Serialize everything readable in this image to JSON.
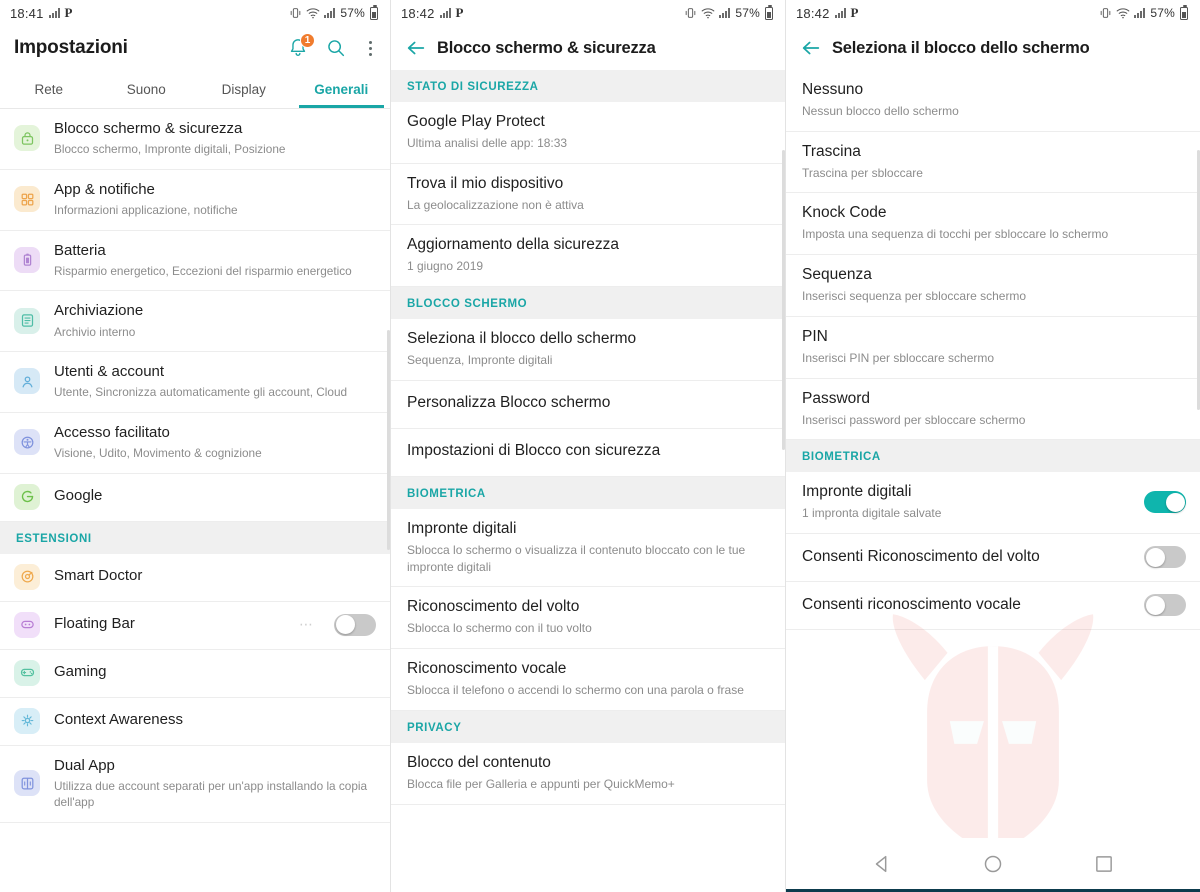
{
  "statusbar": {
    "time_left": "18:41",
    "time_mid": "18:42",
    "time_right": "18:42",
    "carrier_glyph": "P",
    "battery_pct": "57%",
    "icons": [
      "signal-bars-icon",
      "vibrate-icon",
      "wifi-icon",
      "cellular-icon",
      "battery-icon"
    ]
  },
  "colors": {
    "accent_teal": "#1aa6a6",
    "toggle_on": "#0fb5ad",
    "badge_orange": "#f07c2e",
    "section_bg": "#f0f0f0",
    "navbar_line": "#0d3b4d"
  },
  "left": {
    "title": "Impostazioni",
    "notification_count": "1",
    "actions": [
      "notifications-bell-icon",
      "search-icon",
      "overflow-menu-icon"
    ],
    "tabs": [
      {
        "label": "Rete",
        "active": false
      },
      {
        "label": "Suono",
        "active": false
      },
      {
        "label": "Display",
        "active": false
      },
      {
        "label": "Generali",
        "active": true
      }
    ],
    "items": [
      {
        "title": "Blocco schermo & sicurezza",
        "sub": "Blocco schermo, Impronte digitali, Posizione",
        "icon": "lock-icon",
        "color": "#8ed07a",
        "bg": "#e4f4da"
      },
      {
        "title": "App & notifiche",
        "sub": "Informazioni applicazione, notifiche",
        "icon": "apps-icon",
        "color": "#f0ad5a",
        "bg": "#fbeacf"
      },
      {
        "title": "Batteria",
        "sub": "Risparmio energetico, Eccezioni del risparmio energetico",
        "icon": "battery-icon",
        "color": "#b98fd6",
        "bg": "#eddcf6"
      },
      {
        "title": "Archiviazione",
        "sub": "Archivio interno",
        "icon": "storage-icon",
        "color": "#5bc2ae",
        "bg": "#d9f0ea"
      },
      {
        "title": "Utenti & account",
        "sub": "Utente, Sincronizza automaticamente gli account, Cloud",
        "icon": "person-icon",
        "color": "#6fb4dd",
        "bg": "#d6e9f6"
      },
      {
        "title": "Accesso facilitato",
        "sub": "Visione, Udito, Movimento & cognizione",
        "icon": "accessibility-icon",
        "color": "#8a9ede",
        "bg": "#dde2f7"
      },
      {
        "title": "Google",
        "sub": "",
        "icon": "google-g-icon",
        "color": "#7ac85c",
        "bg": "#dff2d4"
      }
    ],
    "extensions_header": "ESTENSIONI",
    "extensions": [
      {
        "title": "Smart Doctor",
        "sub": "",
        "icon": "smart-doctor-icon",
        "color": "#f3b15e",
        "bg": "#fceed7",
        "toggle": null
      },
      {
        "title": "Floating Bar",
        "sub": "",
        "icon": "floating-bar-icon",
        "color": "#c48ede",
        "bg": "#f1dff9",
        "toggle": "off",
        "ellipsis": "⋯"
      },
      {
        "title": "Gaming",
        "sub": "",
        "icon": "gaming-icon",
        "color": "#5fc9a6",
        "bg": "#d9f2e8",
        "toggle": null
      },
      {
        "title": "Context Awareness",
        "sub": "",
        "icon": "context-awareness-icon",
        "color": "#6ebfdd",
        "bg": "#d8eef7",
        "toggle": null
      },
      {
        "title": "Dual App",
        "sub": "Utilizza due account separati per un'app installando la copia dell'app",
        "icon": "dual-app-icon",
        "color": "#8a9ede",
        "bg": "#dde2f7",
        "toggle": null
      }
    ]
  },
  "middle": {
    "title": "Blocco schermo & sicurezza",
    "back_icon": "back-arrow-icon",
    "sections": [
      {
        "header": "STATO DI SICUREZZA",
        "items": [
          {
            "title": "Google Play Protect",
            "sub": "Ultima analisi delle app: 18:33"
          },
          {
            "title": "Trova il mio dispositivo",
            "sub": "La geolocalizzazione non è attiva"
          },
          {
            "title": "Aggiornamento della sicurezza",
            "sub": "1 giugno 2019"
          }
        ]
      },
      {
        "header": "BLOCCO SCHERMO",
        "items": [
          {
            "title": "Seleziona il blocco dello schermo",
            "sub": "Sequenza, Impronte digitali"
          },
          {
            "title": "Personalizza Blocco schermo",
            "sub": ""
          },
          {
            "title": "Impostazioni di Blocco con sicurezza",
            "sub": ""
          }
        ]
      },
      {
        "header": "BIOMETRICA",
        "items": [
          {
            "title": "Impronte digitali",
            "sub": "Sblocca lo schermo o visualizza il contenuto bloccato con le tue impronte digitali"
          },
          {
            "title": "Riconoscimento del volto",
            "sub": "Sblocca lo schermo con il tuo volto"
          },
          {
            "title": "Riconoscimento vocale",
            "sub": "Sblocca il telefono o accendi lo schermo con una parola o frase"
          }
        ]
      },
      {
        "header": "PRIVACY",
        "items": [
          {
            "title": "Blocco del contenuto",
            "sub": "Blocca file per Galleria e appunti per QuickMemo+"
          }
        ]
      }
    ]
  },
  "right": {
    "title": "Seleziona il blocco dello schermo",
    "back_icon": "back-arrow-icon",
    "lock_options": [
      {
        "title": "Nessuno",
        "sub": "Nessun blocco dello schermo"
      },
      {
        "title": "Trascina",
        "sub": "Trascina per sbloccare"
      },
      {
        "title": "Knock Code",
        "sub": "Imposta una sequenza di tocchi per sbloccare lo schermo"
      },
      {
        "title": "Sequenza",
        "sub": "Inserisci sequenza per sbloccare schermo"
      },
      {
        "title": "PIN",
        "sub": "Inserisci PIN per sbloccare schermo"
      },
      {
        "title": "Password",
        "sub": "Inserisci password per sbloccare schermo"
      }
    ],
    "biometric_header": "BIOMETRICA",
    "biometric_items": [
      {
        "title": "Impronte digitali",
        "sub": "1 impronta digitale salvate",
        "toggle": "on"
      },
      {
        "title": "Consenti Riconoscimento del volto",
        "sub": "",
        "toggle": "off"
      },
      {
        "title": "Consenti riconoscimento vocale",
        "sub": "",
        "toggle": "off"
      }
    ],
    "navbar": [
      "back-triangle-icon",
      "home-circle-icon",
      "recents-square-icon"
    ]
  }
}
